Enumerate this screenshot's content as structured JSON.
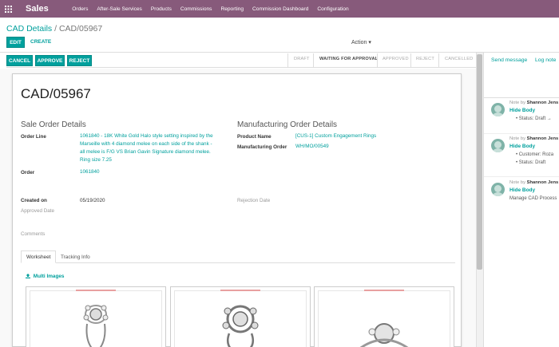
{
  "app": {
    "name": "Sales",
    "icon": "apps-grid-icon"
  },
  "menu": [
    "Orders",
    "After-Sale Services",
    "Products",
    "Commissions",
    "Reporting",
    "Commission Dashboard",
    "Configuration"
  ],
  "breadcrumb": {
    "parent": "CAD Details",
    "separator": "/",
    "current": "CAD/05967"
  },
  "toolbar": {
    "edit": "EDIT",
    "create": "CREATE",
    "action": "Action"
  },
  "header_buttons": {
    "cancel": "CANCEL",
    "approve": "APPROVE",
    "reject": "REJECT"
  },
  "stages": [
    {
      "label": "DRAFT",
      "active": false
    },
    {
      "label": "WAITING FOR APPROVAL",
      "active": true
    },
    {
      "label": "APPROVED",
      "active": false
    },
    {
      "label": "REJECT",
      "active": false
    },
    {
      "label": "CANCELLED",
      "active": false
    }
  ],
  "record": {
    "title": "CAD/05967"
  },
  "sale_order": {
    "heading": "Sale Order Details",
    "order_line_label": "Order Line",
    "order_line_lines": [
      "1061840 - 18K White Gold Halo style setting inspired by the",
      "Marseille with 4 diamond melee on each side of the shank -",
      "all melee is F/G VS Brian Gavin Signature diamond melee.",
      "Ring size 7.25"
    ],
    "order_label": "Order",
    "order_value": "1061840"
  },
  "manufacturing": {
    "heading": "Manufacturing Order Details",
    "product_label": "Product Name",
    "product_value": "[CUS-1] Custom Engagement Rings",
    "mo_label": "Manufacturing Order",
    "mo_value": "WH/MO/00549"
  },
  "dates": {
    "created_label": "Created on",
    "created_value": "05/19/2020",
    "approved_label": "Approved Date",
    "rejection_label": "Rejection Date"
  },
  "comments_label": "Comments",
  "tabs": [
    {
      "label": "Worksheet",
      "active": true
    },
    {
      "label": "Tracking Info",
      "active": false
    }
  ],
  "multi_images": {
    "label": "Multi Images",
    "icon": "upload-icon"
  },
  "chatter": {
    "send_message": "Send message",
    "log_note": "Log note",
    "messages": [
      {
        "note_prefix": "Note by",
        "author": "Shannon Jens",
        "toggle": "Hide Body",
        "details": [
          "Status: Draft →"
        ]
      },
      {
        "note_prefix": "Note by",
        "author": "Shannon Jens",
        "toggle": "Hide Body",
        "details": [
          "Customer: Roza",
          "Status: Draft"
        ]
      },
      {
        "note_prefix": "Note by",
        "author": "Shannon Jens",
        "toggle": "Hide Body",
        "body": "Manage CAD Process"
      }
    ]
  },
  "colors": {
    "brand": "#875a7b",
    "accent": "#00a09d"
  }
}
